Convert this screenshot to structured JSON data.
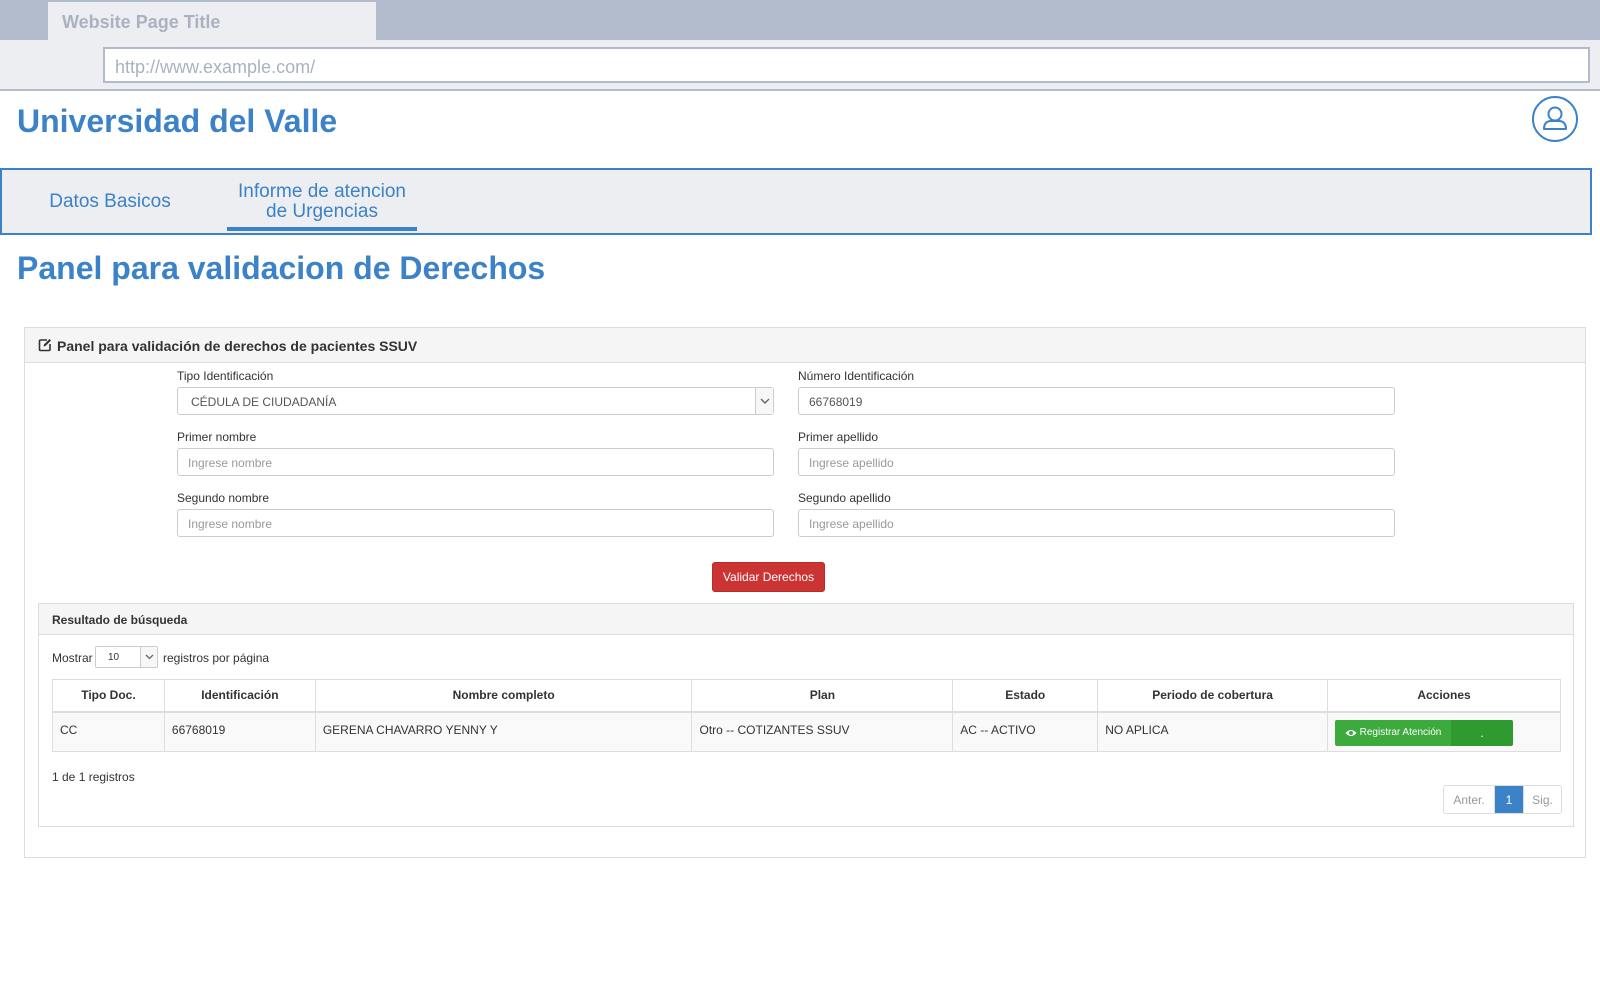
{
  "browser": {
    "tab_title": "Website Page Title",
    "url": "http://www.example.com/"
  },
  "header": {
    "app_title": "Universidad del Valle",
    "avatar_icon": "user-icon"
  },
  "nav": {
    "tabs": [
      {
        "label": "Datos Basicos",
        "active": false
      },
      {
        "label_line1": "Informe de atencion",
        "label_line2": "de Urgencias",
        "active": true
      }
    ]
  },
  "page": {
    "title": "Panel para validacion de Derechos"
  },
  "panel": {
    "title": "Panel para validación de derechos de pacientes SSUV",
    "icon": "edit-icon",
    "form": {
      "tipo_id": {
        "label": "Tipo Identificación",
        "value": "CÉDULA DE CIUDADANÍA"
      },
      "numero_id": {
        "label": "Número Identificación",
        "value": "66768019"
      },
      "primer_nombre": {
        "label": "Primer nombre",
        "placeholder": "Ingrese nombre"
      },
      "primer_apellido": {
        "label": "Primer apellido",
        "placeholder": "Ingrese apellido"
      },
      "segundo_nombre": {
        "label": "Segundo nombre",
        "placeholder": "Ingrese nombre"
      },
      "segundo_apellido": {
        "label": "Segundo apellido",
        "placeholder": "Ingrese apellido"
      },
      "submit_label": "Validar Derechos"
    },
    "results": {
      "title": "Resultado de búsqueda",
      "show_label": "Mostrar",
      "page_size": "10",
      "per_page_label": "registros por página",
      "columns": [
        "Tipo Doc.",
        "Identificación",
        "Nombre completo",
        "Plan",
        "Estado",
        "Periodo de cobertura",
        "Acciones"
      ],
      "rows": [
        {
          "tipo_doc": "CC",
          "identificacion": "66768019",
          "nombre": "GERENA CHAVARRO YENNY Y",
          "plan": "Otro -- COTIZANTES SSUV",
          "estado": "AC -- ACTIVO",
          "periodo": "NO APLICA",
          "action_label": "Registrar Atención",
          "action_extra": "."
        }
      ],
      "info": "1 de 1 registros",
      "pager": {
        "prev": "Anter.",
        "current": "1",
        "next": "Sig."
      }
    }
  },
  "colors": {
    "brand": "#3b82c9",
    "danger": "#cc3333",
    "success": "#3caa3c"
  }
}
